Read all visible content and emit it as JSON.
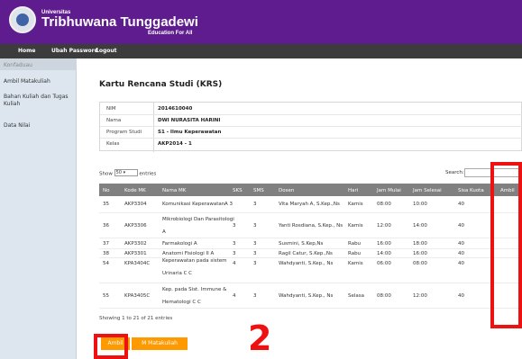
{
  "header": {
    "uni_small": "Universitas",
    "uni_name": "Tribhuwana Tunggadewi",
    "tagline": "Education For All"
  },
  "nav": [
    "Home",
    "Ubah Password",
    "Logout"
  ],
  "sidebar": {
    "heading": "Konfaduau",
    "items": [
      "Ambil Matakuliah",
      "Bahan Kuliah dan Tugas",
      "Kuliah",
      "Data Nilai"
    ]
  },
  "page_title": "Kartu Rencana Studi (KRS)",
  "info": [
    {
      "label": "NIM",
      "value": "2014610040"
    },
    {
      "label": "Nama",
      "value": "DWI NURASITA HARINI"
    },
    {
      "label": "Program Studi",
      "value": "S1 - Ilmu Keperawatan"
    },
    {
      "label": "Kelas",
      "value": "AKP2014 - 1"
    }
  ],
  "table_controls": {
    "show_prefix": "Show",
    "show_value": "50",
    "show_suffix": "entries",
    "search_label": "Search:"
  },
  "table": {
    "headers": [
      "No",
      "Kode MK",
      "Nama MK",
      "SKS",
      "SMS",
      "Dosen",
      "Hari",
      "Jam Mulai",
      "Jam Selesai",
      "Sisa Kuota",
      "Ambil"
    ],
    "rows": [
      {
        "no": "35",
        "kode": "AKP3304",
        "nama": [
          "Komunikasi Keperawatan",
          "A 3"
        ],
        "sks": "",
        "sms": "3",
        "dosen": "Vita Maryah A, S.Kep.,Ns",
        "hari": "Kamis",
        "mulai": "08:00",
        "selesai": "10:00",
        "sisa": "40"
      },
      {
        "no": "36",
        "kode": "AKP3306",
        "nama": [
          "Mikrobiologi Dan Parasitologi",
          "A"
        ],
        "sks": "3",
        "sms": "3",
        "dosen": "Yanti Rosdiana, S.Kep., Ns",
        "hari": "Kamis",
        "mulai": "12:00",
        "selesai": "14:00",
        "sisa": "40"
      },
      {
        "no": "37",
        "kode": "AKP3302",
        "nama": [
          "Farmakologi A"
        ],
        "sks": "3",
        "sms": "3",
        "dosen": "Susmini, S.Kep,Ns",
        "hari": "Rabu",
        "mulai": "16:00",
        "selesai": "18:00",
        "sisa": "40"
      },
      {
        "no": "38",
        "kode": "AKP3301",
        "nama": [
          "Anatomi Fisiologi II A"
        ],
        "sks": "3",
        "sms": "3",
        "dosen": "Ragil Catur, S.Kep.,Ns",
        "hari": "Rabu",
        "mulai": "14:00",
        "selesai": "16:00",
        "sisa": "40"
      },
      {
        "no": "54",
        "kode": "KPA3404C",
        "nama": [
          "Keperawatan pada sistem",
          "Urinaria C C"
        ],
        "sks": "4",
        "sms": "3",
        "dosen": "Wahdyanti, S.Kep., Ns",
        "hari": "Kamis",
        "mulai": "06:00",
        "selesai": "08:00",
        "sisa": "40"
      },
      {
        "no": "55",
        "kode": "KPA3405C",
        "nama": [
          "Kep. pada Sist. Immune &",
          "Hematologi C C"
        ],
        "sks": "4",
        "sms": "3",
        "dosen": "Wahdyanti, S.Kep., Ns",
        "hari": "Selasa",
        "mulai": "08:00",
        "selesai": "12:00",
        "sisa": "40"
      }
    ]
  },
  "showing_text": "Showing 1 to 21 of 21 entries",
  "buttons": {
    "ambil": "Ambil",
    "matakuliah": "M Matakuliah"
  },
  "annotation": {
    "number": "2",
    "color": "#ee1111"
  },
  "colors": {
    "header_bg": "#5e1c8e",
    "nav_bg": "#3c3c3c",
    "button_bg": "#ff9900",
    "table_head_bg": "#808080"
  }
}
